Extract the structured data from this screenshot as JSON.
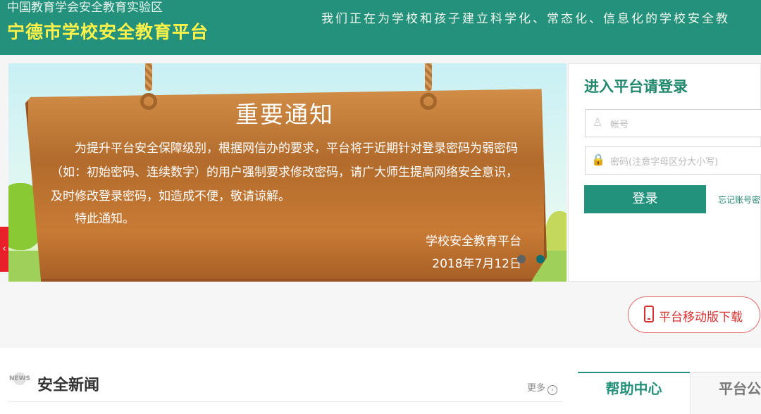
{
  "header": {
    "supertitle": "中国教育学会安全教育实验区",
    "title": "宁德市学校安全教育平台",
    "slogan": "我们正在为学校和孩子建立科学化、常态化、信息化的学校安全教"
  },
  "notice": {
    "title": "重要通知",
    "body": "为提升平台安全保障级别，根据网信办的要求，平台将于近期针对登录密码为弱密码（如：初始密码、连续数字）的用户强制要求修改密码，请广大师生提高网络安全意识，及时修改登录密码，如造成不便，敬请谅解。",
    "closing": "特此通知。",
    "signature": "学校安全教育平台",
    "date": "2018年7月12日",
    "colors": {
      "active_dot": "#0d6e70",
      "inactive_dot": "#5d6463"
    }
  },
  "login": {
    "title": "进入平台请登录",
    "account_placeholder": "帐号",
    "password_placeholder": "密码(注意字母区分大小写)",
    "button": "登录",
    "forgot": "忘记账号密"
  },
  "mobile_download": {
    "label": "平台移动版下载"
  },
  "news": {
    "badge": "NEWS",
    "title": "安全新闻",
    "more": "更多"
  },
  "tabs": [
    {
      "label": "帮助中心",
      "active": true
    },
    {
      "label": "平台公",
      "active": false
    }
  ]
}
